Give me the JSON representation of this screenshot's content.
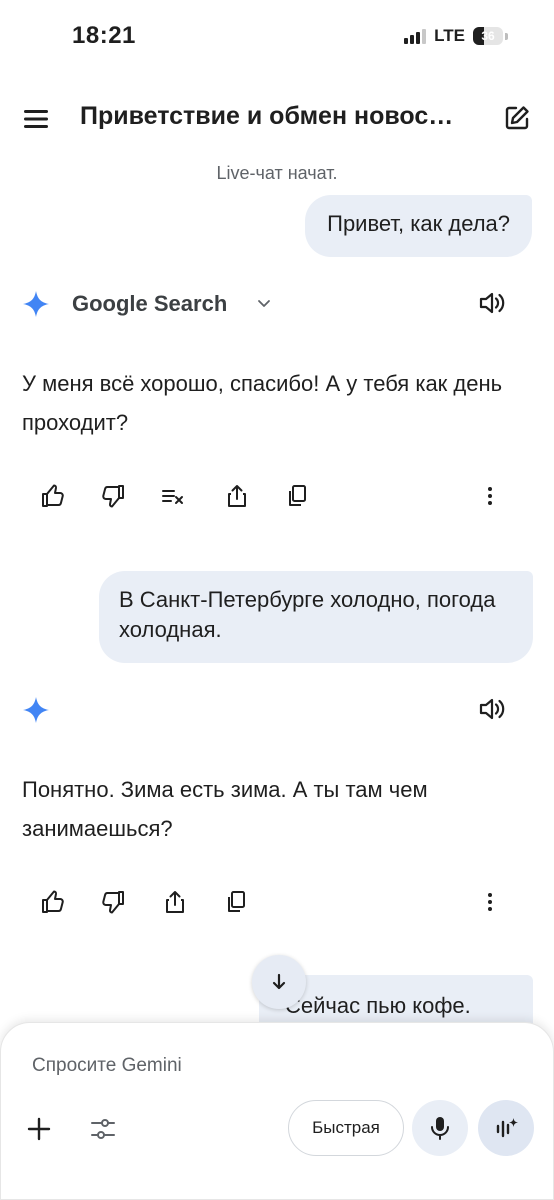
{
  "status_bar": {
    "time": "18:21",
    "network": "LTE",
    "battery": "36",
    "battery_level": 0.36,
    "signal_bars_filled": 3
  },
  "header": {
    "title": "Приветствие и обмен новос…",
    "menu_icon": "menu-icon",
    "edit_icon": "edit-icon"
  },
  "conversation": {
    "live_note": "Live-чат начат.",
    "user_message_1": "Привет, как дела?",
    "tool_label": "Google Search",
    "gemini_reply_1": "У меня всё хорошо, спасибо! А у тебя как день проходит?",
    "user_message_2": "В Санкт-Петербурге холодно, погода холодная.",
    "gemini_reply_2": "Понятно. Зима есть зима. А ты там чем занимаешься?",
    "user_message_3": "Сейчас пью кофе."
  },
  "input_panel": {
    "placeholder": "Спросите Gemini",
    "mode_label": "Быстрая"
  },
  "colors": {
    "bubble": "#e9eef6",
    "accent_blue": "#1a73e8",
    "text": "#1f1f1f",
    "muted": "#5f6368"
  }
}
